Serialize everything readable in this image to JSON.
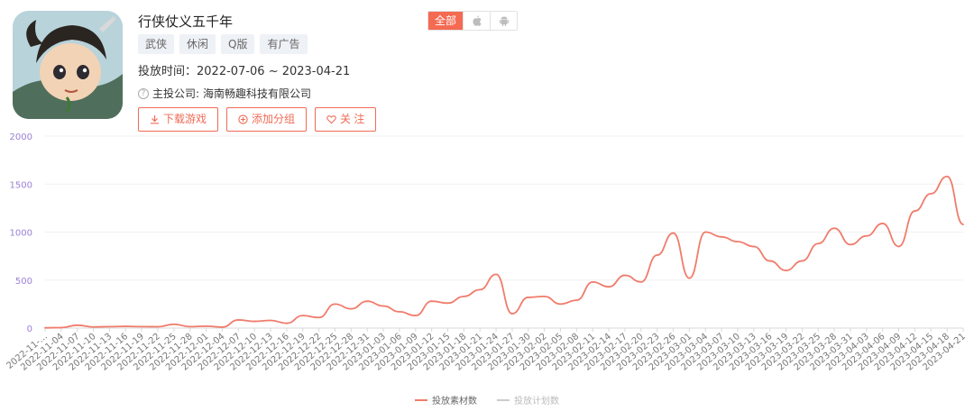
{
  "game": {
    "title": "行侠仗义五千年",
    "tags": [
      "武侠",
      "休闲",
      "Q版",
      "有广告"
    ],
    "period_label": "投放时间：",
    "period_value": "2022-07-06 ~ 2023-04-21",
    "company_label": "主投公司:",
    "company_value": "海南畅趣科技有限公司"
  },
  "platform_tabs": {
    "all": "全部",
    "ios_icon": "apple-icon",
    "android_icon": "android-icon"
  },
  "actions": {
    "download": "下载游戏",
    "add_group": "添加分组",
    "follow": "关 注"
  },
  "colors": {
    "accent": "#f46a52",
    "series_main": "#f07c6c",
    "series_secondary": "#cccccc",
    "axis_label": "#9b7fd6"
  },
  "chart_data": {
    "type": "line",
    "title": "",
    "xlabel": "",
    "ylabel": "",
    "ylim": [
      0,
      2000
    ],
    "yticks": [
      0,
      500,
      1000,
      1500,
      2000
    ],
    "x_tick_labels": [
      "2022-11-…",
      "2022-11-04",
      "2022-11-07",
      "2022-11-10",
      "2022-11-13",
      "2022-11-16",
      "2022-11-19",
      "2022-11-22",
      "2022-11-25",
      "2022-11-28",
      "2022-12-01",
      "2022-12-04",
      "2022-12-07",
      "2022-12-10",
      "2022-12-13",
      "2022-12-16",
      "2022-12-19",
      "2022-12-22",
      "2022-12-25",
      "2022-12-28",
      "2022-12-31",
      "2023-01-03",
      "2023-01-06",
      "2023-01-09",
      "2023-01-12",
      "2023-01-15",
      "2023-01-18",
      "2023-01-21",
      "2023-01-24",
      "2023-01-27",
      "2023-01-30",
      "2023-02-02",
      "2023-02-05",
      "2023-02-08",
      "2023-02-11",
      "2023-02-14",
      "2023-02-17",
      "2023-02-20",
      "2023-02-23",
      "2023-02-26",
      "2023-03-01",
      "2023-03-04",
      "2023-03-07",
      "2023-03-10",
      "2023-03-13",
      "2023-03-16",
      "2023-03-19",
      "2023-03-22",
      "2023-03-25",
      "2023-03-28",
      "2023-03-31",
      "2023-04-03",
      "2023-04-06",
      "2023-04-09",
      "2023-04-12",
      "2023-04-15",
      "2023-04-18",
      "2023-04-21"
    ],
    "x_dates": [
      "2022-11-01",
      "2022-11-04",
      "2022-11-07",
      "2022-11-10",
      "2022-11-13",
      "2022-11-16",
      "2022-11-19",
      "2022-11-22",
      "2022-11-25",
      "2022-11-28",
      "2022-12-01",
      "2022-12-04",
      "2022-12-07",
      "2022-12-10",
      "2022-12-13",
      "2022-12-16",
      "2022-12-19",
      "2022-12-22",
      "2022-12-25",
      "2022-12-28",
      "2022-12-31",
      "2023-01-03",
      "2023-01-06",
      "2023-01-09",
      "2023-01-12",
      "2023-01-15",
      "2023-01-18",
      "2023-01-21",
      "2023-01-24",
      "2023-01-27",
      "2023-01-30",
      "2023-02-02",
      "2023-02-05",
      "2023-02-08",
      "2023-02-11",
      "2023-02-14",
      "2023-02-17",
      "2023-02-20",
      "2023-02-23",
      "2023-02-26",
      "2023-03-01",
      "2023-03-04",
      "2023-03-07",
      "2023-03-10",
      "2023-03-13",
      "2023-03-16",
      "2023-03-19",
      "2023-03-22",
      "2023-03-25",
      "2023-03-28",
      "2023-03-31",
      "2023-04-03",
      "2023-04-06",
      "2023-04-09",
      "2023-04-12",
      "2023-04-15",
      "2023-04-18",
      "2023-04-21"
    ],
    "series": [
      {
        "name": "投放素材数",
        "color": "#f07c6c",
        "values": [
          3,
          5,
          30,
          12,
          15,
          18,
          15,
          14,
          40,
          15,
          20,
          10,
          85,
          70,
          80,
          50,
          130,
          110,
          250,
          200,
          280,
          230,
          170,
          130,
          280,
          260,
          330,
          400,
          560,
          150,
          320,
          330,
          250,
          290,
          480,
          430,
          550,
          480,
          760,
          990,
          520,
          1000,
          950,
          900,
          850,
          700,
          600,
          700,
          880,
          1040,
          870,
          960,
          1090,
          850,
          1220,
          1400,
          1580,
          1080
        ]
      },
      {
        "name": "投放计划数",
        "color": "#cccccc",
        "values": []
      }
    ],
    "legend_position": "bottom-center",
    "grid": true
  }
}
